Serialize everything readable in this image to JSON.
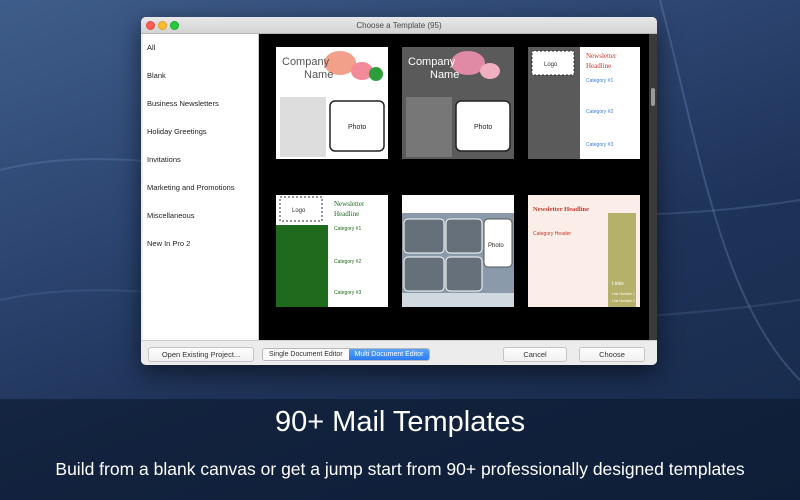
{
  "window": {
    "title": "Choose a Template (95)"
  },
  "sidebar": {
    "items": [
      {
        "label": "All"
      },
      {
        "label": "Blank"
      },
      {
        "label": "Business Newsletters"
      },
      {
        "label": "Holiday Greetings"
      },
      {
        "label": "Invitations"
      },
      {
        "label": "Marketing and Promotions"
      },
      {
        "label": "Miscellaneous"
      },
      {
        "label": "New In Pro 2"
      }
    ]
  },
  "templates": {
    "t1": {
      "company": "Company",
      "name": "Name",
      "photo": "Photo"
    },
    "t2": {
      "company": "Company",
      "name": "Name",
      "photo": "Photo"
    },
    "t3": {
      "logo": "Logo",
      "headline1": "Newsletter",
      "headline2": "Headline",
      "cat1": "Category #1",
      "cat2": "Category #2",
      "cat3": "Category #3"
    },
    "t4": {
      "logo": "Logo",
      "headline1": "Newsletter",
      "headline2": "Headline",
      "cat1": "Category #1",
      "cat2": "Category #2",
      "cat3": "Category #3"
    },
    "t5": {
      "photo": "Photo"
    },
    "t6": {
      "headline": "Newsletter Headline",
      "cat": "Category Header",
      "links": "Links",
      "link1": "Link Number 1",
      "link2": "Link Number 2"
    }
  },
  "buttons": {
    "open_existing": "Open Existing Project...",
    "single_editor": "Single Document Editor",
    "multi_editor": "Multi Document Editor",
    "cancel": "Cancel",
    "choose": "Choose"
  },
  "promo": {
    "headline": "90+ Mail Templates",
    "subtitle": "Build from a blank canvas or get a jump start from 90+ professionally designed templates"
  },
  "colors": {
    "accent": "#2a7cf0",
    "newsletter_red": "#c0392b",
    "category_blue": "#3a7bd5",
    "green": "#1e6b1e"
  }
}
